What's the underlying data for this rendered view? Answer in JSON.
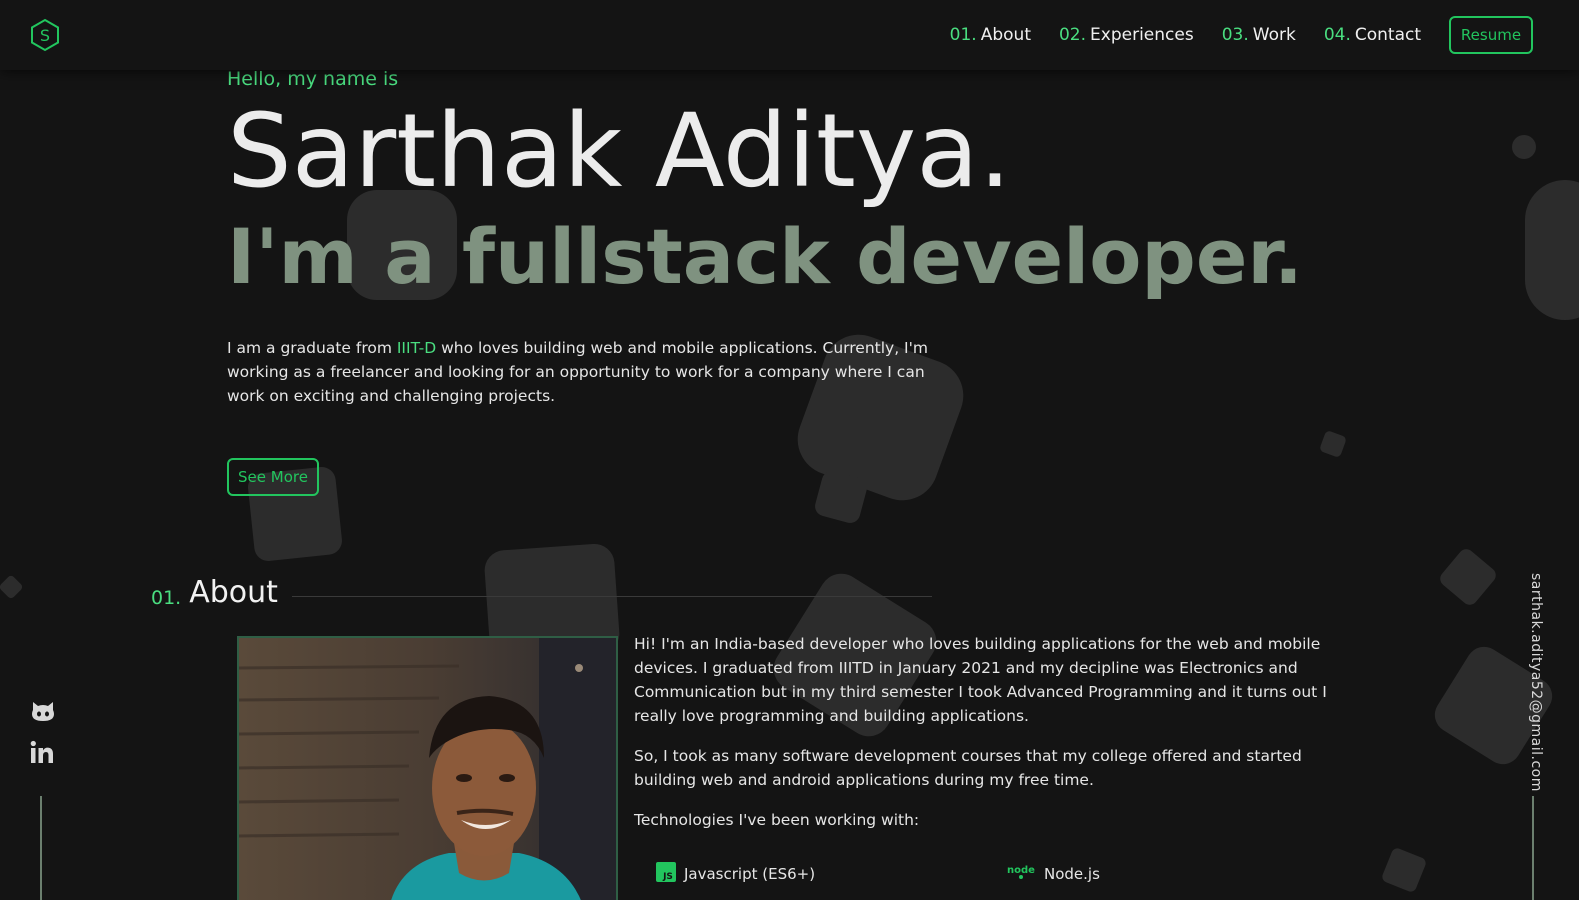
{
  "header": {
    "logo_icon": "hexagon-s-logo-icon",
    "nav": [
      {
        "num": "01.",
        "label": "About"
      },
      {
        "num": "02.",
        "label": "Experiences"
      },
      {
        "num": "03.",
        "label": "Work"
      },
      {
        "num": "04.",
        "label": "Contact"
      }
    ],
    "resume_label": "Resume"
  },
  "hero": {
    "greeting": "Hello, my name is",
    "name": "Sarthak Aditya.",
    "tagline": "I'm a fullstack developer.",
    "intro_before": "I am a graduate from ",
    "intro_highlight": "IIIT-D",
    "intro_after": " who loves building web and mobile applications. Currently, I'm working as a freelancer and looking for an opportunity to work for a company where I can work on exciting and challenging projects.",
    "see_more_label": "See More"
  },
  "about": {
    "num": "01.",
    "title": "About",
    "paragraphs": [
      "Hi! I'm an India-based developer who loves building applications for the web and mobile devices. I graduated from IIITD in January 2021 and my decipline was Electronics and Communication but in my third semester I took Advanced Programming and it turns out I really love programming and building applications.",
      "So, I took as many software development courses that my college offered and started building web and android applications during my free time.",
      "Technologies I've been working with:"
    ],
    "technologies": [
      {
        "label": "Javascript (ES6+)",
        "icon": "javascript-icon"
      },
      {
        "label": "Node.js",
        "icon": "nodejs-icon"
      }
    ]
  },
  "social": {
    "icons": [
      "github-icon",
      "linkedin-icon"
    ]
  },
  "email": "sarthak.aditya52@gmail.com",
  "colors": {
    "background": "#141414",
    "accent": "#4ade80",
    "tagline": "#7f9280"
  }
}
